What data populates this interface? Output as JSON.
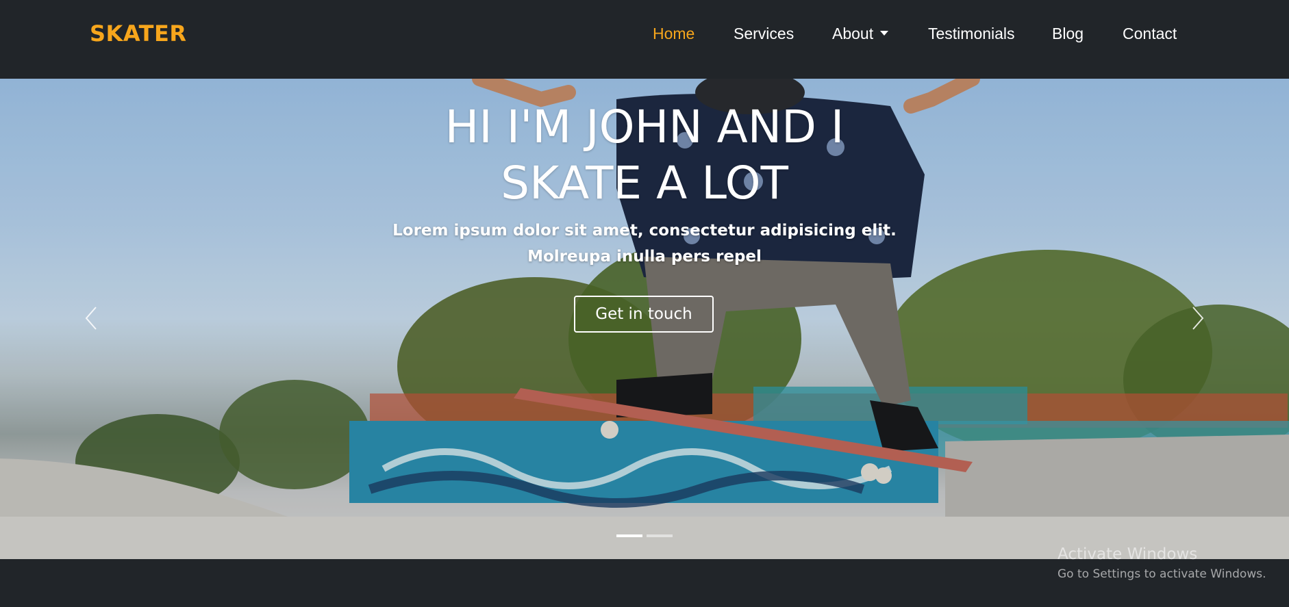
{
  "brand": {
    "name": "SKATER"
  },
  "nav": {
    "items": [
      {
        "label": "Home",
        "active": true
      },
      {
        "label": "Services"
      },
      {
        "label": "About",
        "dropdown": true
      },
      {
        "label": "Testimonials"
      },
      {
        "label": "Blog"
      },
      {
        "label": "Contact"
      }
    ]
  },
  "hero": {
    "title_line1": "HI I'M JOHN AND I",
    "title_line2": "SKATE A LOT",
    "subtitle_line1": "Lorem ipsum dolor sit amet, consectetur adipisicing elit.",
    "subtitle_line2": "Molreupa inulla pers repel",
    "cta_label": "Get in touch",
    "prev_icon": "chevron-left-icon",
    "next_icon": "chevron-right-icon",
    "slide_count": 2,
    "active_slide": 1
  },
  "watermark": {
    "line1": "Activate Windows",
    "line2": "Go to Settings to activate Windows."
  },
  "colors": {
    "accent": "#f7a61c",
    "navbar_bg": "#212529",
    "text": "#ffffff"
  }
}
